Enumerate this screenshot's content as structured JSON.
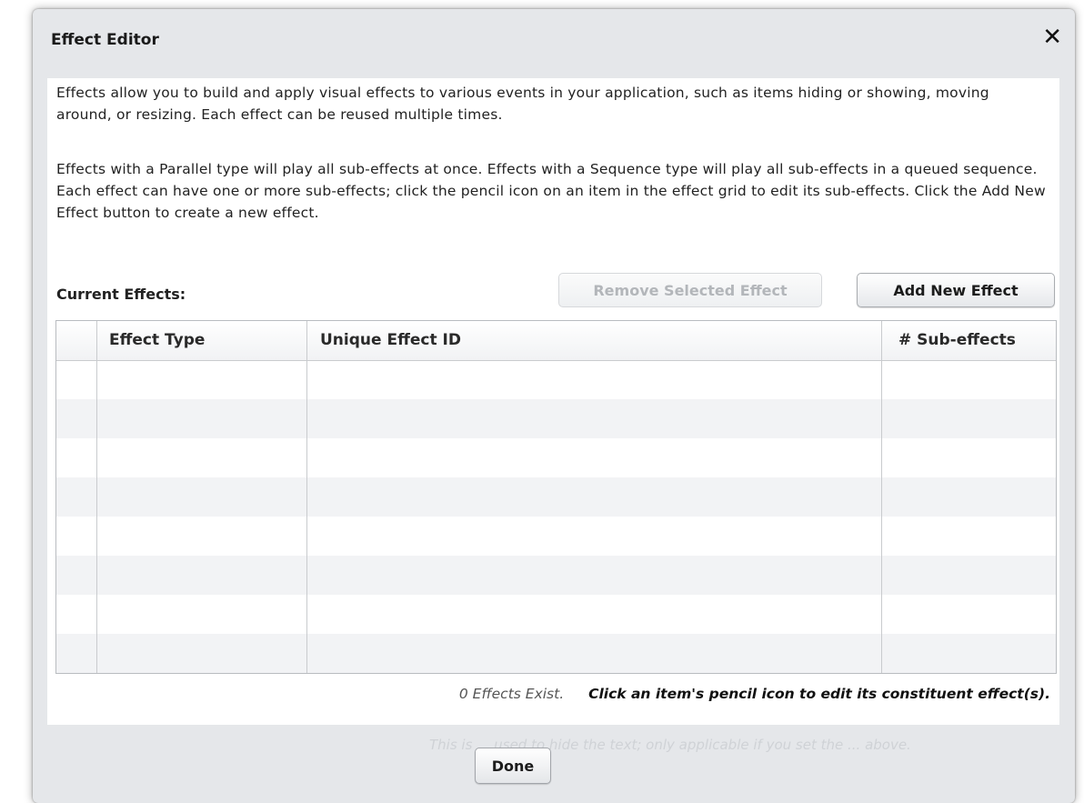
{
  "dialog": {
    "title": "Effect Editor",
    "close_glyph": "✕",
    "description_1": "Effects allow you to build and apply visual effects to various events in your application, such as items hiding or showing, moving around, or resizing.  Each effect can be reused multiple times.",
    "description_2": "Effects with a Parallel type will play all sub-effects at once.  Effects with a Sequence type will play all sub-effects in a queued sequence.  Each effect can have one or more sub-effects; click the pencil icon on an item in the effect grid to edit its sub-effects.  Click the Add New Effect button to create a new effect."
  },
  "effects": {
    "current_label": "Current Effects:",
    "remove_button": "Remove Selected Effect",
    "add_button": "Add New Effect",
    "columns": [
      "",
      "Effect Type",
      "Unique Effect ID",
      "# Sub-effects"
    ],
    "rows": []
  },
  "footer": {
    "count_text": "0 Effects Exist.",
    "hint_text": "Click an item's pencil icon to edit its constituent effect(s).",
    "done_button": "Done"
  }
}
